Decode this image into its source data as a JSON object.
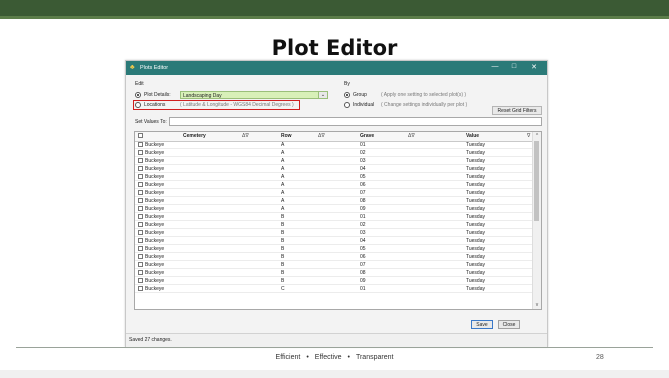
{
  "slide": {
    "title": "Plot Editor",
    "footer": {
      "items": [
        "Efficient",
        "Effective",
        "Transparent"
      ],
      "separator": "•"
    },
    "page_number": "28"
  },
  "window": {
    "title": "Plots Editor",
    "controls": {
      "minimize": "—",
      "maximize": "□",
      "close": "✕"
    },
    "edit": {
      "label": "Edit",
      "plot_details_label": "Plot Details:",
      "plot_details_value": "Landscaping Day",
      "locations_label": "Locations",
      "locations_hint": "( Latitude & Longitude - WGS84 Decimal Degrees )",
      "selected": "plot_details"
    },
    "by": {
      "label": "By",
      "group_label": "Group",
      "group_hint": "( Apply one setting to selected plot(s) )",
      "individual_label": "Individual",
      "individual_hint": "( Change settings individually per plot )",
      "selected": "group"
    },
    "reset_button": "Reset Grid Filters",
    "set_values_label": "Set Values To:",
    "grid": {
      "columns": [
        "Cemetery",
        "Row",
        "Grave",
        "Value"
      ],
      "sort_glyph": "Δ∇",
      "filter_glyph": "∇",
      "rows": [
        {
          "cemetery": "Buckeye",
          "row": "A",
          "grave": "01",
          "value": "Tuesday"
        },
        {
          "cemetery": "Buckeye",
          "row": "A",
          "grave": "02",
          "value": "Tuesday"
        },
        {
          "cemetery": "Buckeye",
          "row": "A",
          "grave": "03",
          "value": "Tuesday"
        },
        {
          "cemetery": "Buckeye",
          "row": "A",
          "grave": "04",
          "value": "Tuesday"
        },
        {
          "cemetery": "Buckeye",
          "row": "A",
          "grave": "05",
          "value": "Tuesday"
        },
        {
          "cemetery": "Buckeye",
          "row": "A",
          "grave": "06",
          "value": "Tuesday"
        },
        {
          "cemetery": "Buckeye",
          "row": "A",
          "grave": "07",
          "value": "Tuesday"
        },
        {
          "cemetery": "Buckeye",
          "row": "A",
          "grave": "08",
          "value": "Tuesday"
        },
        {
          "cemetery": "Buckeye",
          "row": "A",
          "grave": "09",
          "value": "Tuesday"
        },
        {
          "cemetery": "Buckeye",
          "row": "B",
          "grave": "01",
          "value": "Tuesday"
        },
        {
          "cemetery": "Buckeye",
          "row": "B",
          "grave": "02",
          "value": "Tuesday"
        },
        {
          "cemetery": "Buckeye",
          "row": "B",
          "grave": "03",
          "value": "Tuesday"
        },
        {
          "cemetery": "Buckeye",
          "row": "B",
          "grave": "04",
          "value": "Tuesday"
        },
        {
          "cemetery": "Buckeye",
          "row": "B",
          "grave": "05",
          "value": "Tuesday"
        },
        {
          "cemetery": "Buckeye",
          "row": "B",
          "grave": "06",
          "value": "Tuesday"
        },
        {
          "cemetery": "Buckeye",
          "row": "B",
          "grave": "07",
          "value": "Tuesday"
        },
        {
          "cemetery": "Buckeye",
          "row": "B",
          "grave": "08",
          "value": "Tuesday"
        },
        {
          "cemetery": "Buckeye",
          "row": "B",
          "grave": "09",
          "value": "Tuesday"
        },
        {
          "cemetery": "Buckeye",
          "row": "C",
          "grave": "01",
          "value": "Tuesday"
        }
      ]
    },
    "save_button": "Save",
    "close_button": "Close",
    "status": "Saved 27 changes."
  },
  "colors": {
    "slide_band": "#3b5a34",
    "titlebar": "#2b7a78",
    "combo_bg": "#d8f0b8",
    "highlight_box": "#d02020"
  },
  "icons": {
    "app": "plots-editor-icon"
  }
}
